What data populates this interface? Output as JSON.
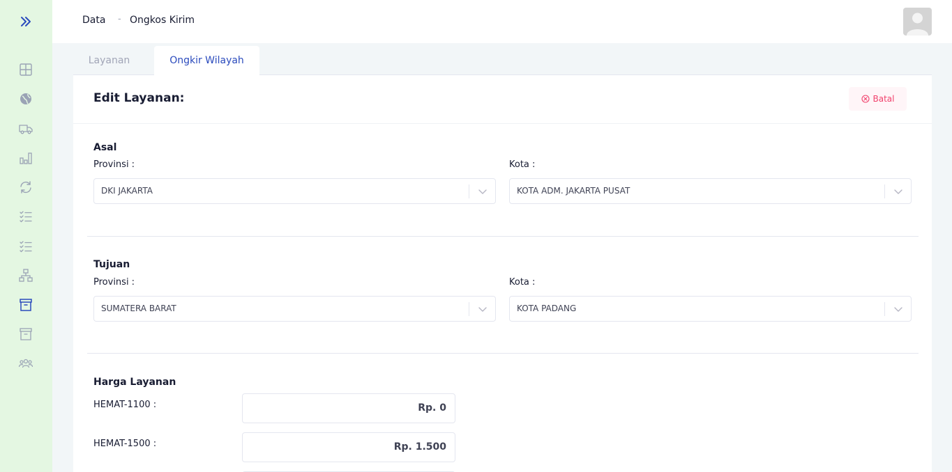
{
  "breadcrumb": {
    "root": "Data",
    "separator": "-",
    "current": "Ongkos Kirim"
  },
  "sidebar": {
    "items": [
      {
        "icon": "grid-icon"
      },
      {
        "icon": "globe-icon"
      },
      {
        "icon": "truck-icon"
      },
      {
        "icon": "bar-chart-icon"
      },
      {
        "icon": "refresh-icon"
      },
      {
        "icon": "checklist-icon"
      },
      {
        "icon": "checklist-icon"
      },
      {
        "icon": "hierarchy-icon"
      },
      {
        "icon": "archive-icon",
        "active": true
      },
      {
        "icon": "archive-icon"
      },
      {
        "icon": "users-icon"
      }
    ]
  },
  "tabs": [
    {
      "label": "Layanan",
      "active": false
    },
    {
      "label": "Ongkir Wilayah",
      "active": true
    }
  ],
  "card": {
    "title": "Edit Layanan:",
    "cancel_label": "Batal"
  },
  "asal": {
    "title": "Asal",
    "provinsi_label": "Provinsi :",
    "provinsi_value": "DKI JAKARTA",
    "kota_label": "Kota :",
    "kota_value": "KOTA ADM. JAKARTA PUSAT"
  },
  "tujuan": {
    "title": "Tujuan",
    "provinsi_label": "Provinsi :",
    "provinsi_value": "SUMATERA BARAT",
    "kota_label": "Kota :",
    "kota_value": "KOTA PADANG"
  },
  "harga": {
    "title": "Harga Layanan",
    "items": [
      {
        "label": "HEMAT-1100 :",
        "value": "Rp. 0"
      },
      {
        "label": "HEMAT-1500 :",
        "value": "Rp. 1.500"
      }
    ]
  },
  "colors": {
    "sidebar_bg": "#e4f7e2",
    "active_tab": "#2b4bbd",
    "danger": "#f1416c",
    "danger_bg": "#fff5f8"
  }
}
